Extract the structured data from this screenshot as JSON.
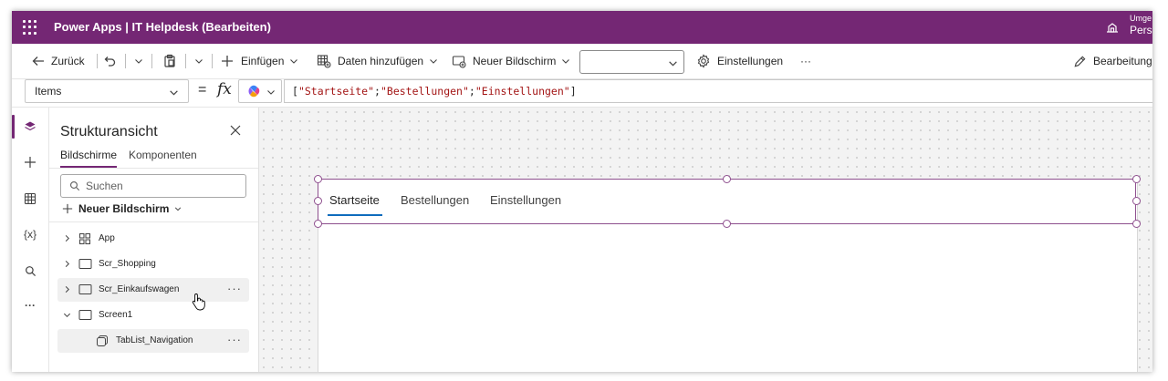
{
  "titlebar": {
    "app_title": "Power Apps  |  IT Helpdesk (Bearbeiten)",
    "environment_label": "Umge",
    "environment_value": "Perso"
  },
  "commandbar": {
    "back": "Zurück",
    "insert": "Einfügen",
    "add_data": "Daten hinzufügen",
    "new_screen": "Neuer Bildschirm",
    "settings": "Einstellungen",
    "more": "···",
    "edit_status": "Bearbeitung..."
  },
  "formulabar": {
    "property": "Items",
    "equals": "=",
    "fx": "fx",
    "formula": {
      "open": "[",
      "v1": "\"Startseite\"",
      "sep1": ";",
      "v2": "\"Bestellungen\"",
      "sep2": ";",
      "v3": "\"Einstellungen\"",
      "close": "]"
    }
  },
  "rail": {
    "items": [
      "layers-icon",
      "plus-icon",
      "table-icon",
      "variables-icon",
      "search-icon",
      "more-icon"
    ],
    "variables_label": "{x}",
    "more_label": "···"
  },
  "tree_panel": {
    "title": "Strukturansicht",
    "tabs": [
      "Bildschirme",
      "Komponenten"
    ],
    "search_placeholder": "Suchen",
    "new_screen": "Neuer Bildschirm",
    "items": [
      {
        "label": "App",
        "icon": "app-icon",
        "expanded": false
      },
      {
        "label": "Scr_Shopping",
        "icon": "screen-icon",
        "expanded": false
      },
      {
        "label": "Scr_Einkaufswagen",
        "icon": "screen-icon",
        "expanded": false,
        "hover": true
      },
      {
        "label": "Screen1",
        "icon": "screen-icon",
        "expanded": true
      },
      {
        "label": "TabList_Navigation",
        "icon": "tablist-icon",
        "selected": true
      }
    ],
    "row_more": "···"
  },
  "canvas": {
    "tabs": [
      "Startseite",
      "Bestellungen",
      "Einstellungen"
    ],
    "selected_tab": "Startseite"
  },
  "colors": {
    "brand": "#742774",
    "tab_indicator": "#0f6cbd",
    "formula_string": "#a31515"
  }
}
